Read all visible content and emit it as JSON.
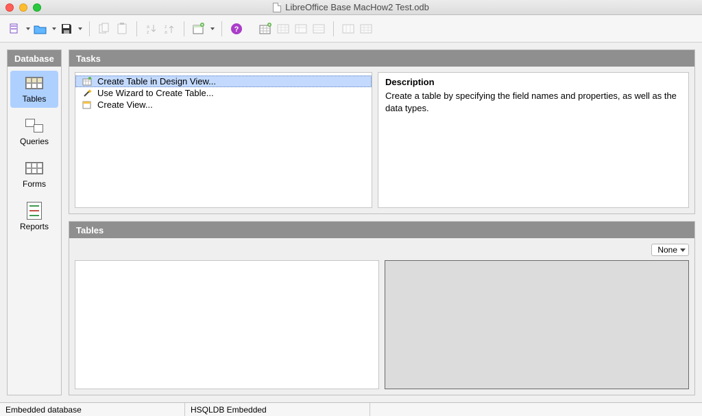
{
  "window": {
    "title": "LibreOffice Base MacHow2 Test.odb"
  },
  "sidebar": {
    "header": "Database",
    "items": [
      {
        "label": "Tables",
        "selected": true
      },
      {
        "label": "Queries",
        "selected": false
      },
      {
        "label": "Forms",
        "selected": false
      },
      {
        "label": "Reports",
        "selected": false
      }
    ]
  },
  "tasks": {
    "header": "Tasks",
    "items": [
      {
        "label": "Create Table in Design View...",
        "selected": true
      },
      {
        "label": "Use Wizard to Create Table...",
        "selected": false
      },
      {
        "label": "Create View...",
        "selected": false
      }
    ],
    "description_title": "Description",
    "description_text": "Create a table by specifying the field names and properties, as well as the data types."
  },
  "tables_panel": {
    "header": "Tables",
    "view_mode": "None"
  },
  "statusbar": {
    "left": "Embedded database",
    "center": "HSQLDB Embedded",
    "right": ""
  }
}
